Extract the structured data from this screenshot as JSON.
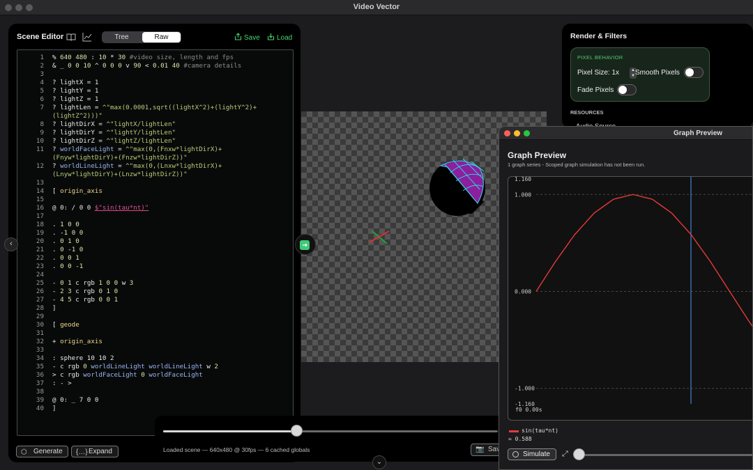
{
  "app": {
    "title": "Video Vector"
  },
  "scene_editor": {
    "title": "Scene Editor",
    "tabs": [
      "Tree",
      "Raw"
    ],
    "active_tab": "Raw",
    "save_label": "Save",
    "load_label": "Load",
    "generate_label": "Generate",
    "expand_label": "Expand",
    "code": [
      {
        "n": "1",
        "t": "% 640 480 : 10 * 30 #video size, length and fps"
      },
      {
        "n": "2",
        "t": "& _ 0 0 10 ^ 0 0 0 v 90 < 0.01 40 #camera details"
      },
      {
        "n": "3",
        "t": ""
      },
      {
        "n": "4",
        "t": "? lightX = 1"
      },
      {
        "n": "5",
        "t": "? lightY = 1"
      },
      {
        "n": "6",
        "t": "? lightZ = 1"
      },
      {
        "n": "7",
        "t": "? lightLen = ^\"max(0.0001,sqrt((lightX^2)+(lightY^2)+"
      },
      {
        "n": "",
        "t": "(lightZ^2)))\""
      },
      {
        "n": "8",
        "t": "? lightDirX = ^\"lightX/lightLen\""
      },
      {
        "n": "9",
        "t": "? lightDirY = ^\"lightY/lightLen\""
      },
      {
        "n": "10",
        "t": "? lightDirZ = ^\"lightZ/lightLen\""
      },
      {
        "n": "11",
        "t": "? worldFaceLight = ^\"max(0,(Fnxw*lightDirX)+"
      },
      {
        "n": "",
        "t": "(Fnyw*lightDirY)+(Fnzw*lightDirZ))\""
      },
      {
        "n": "12",
        "t": "? worldLineLight = ^\"max(0,(Lnxw*lightDirX)+"
      },
      {
        "n": "",
        "t": "(Lnyw*lightDirY)+(Lnzw*lightDirZ))\""
      },
      {
        "n": "13",
        "t": ""
      },
      {
        "n": "14",
        "t": "[ origin_axis"
      },
      {
        "n": "15",
        "t": ""
      },
      {
        "n": "16",
        "t": "@ 0: / 0 0 $\"sin(tau*nt)\""
      },
      {
        "n": "17",
        "t": ""
      },
      {
        "n": "18",
        "t": ". 1 0 0"
      },
      {
        "n": "19",
        "t": ". -1 0 0"
      },
      {
        "n": "20",
        "t": ". 0 1 0"
      },
      {
        "n": "21",
        "t": ". 0 -1 0"
      },
      {
        "n": "22",
        "t": ". 0 0 1"
      },
      {
        "n": "23",
        "t": ". 0 0 -1"
      },
      {
        "n": "24",
        "t": ""
      },
      {
        "n": "25",
        "t": "- 0 1 c rgb 1 0 0 w 3"
      },
      {
        "n": "26",
        "t": "- 2 3 c rgb 0 1 0"
      },
      {
        "n": "27",
        "t": "- 4 5 c rgb 0 0 1"
      },
      {
        "n": "28",
        "t": "]"
      },
      {
        "n": "29",
        "t": ""
      },
      {
        "n": "30",
        "t": "[ geode"
      },
      {
        "n": "31",
        "t": ""
      },
      {
        "n": "32",
        "t": "+ origin_axis"
      },
      {
        "n": "33",
        "t": ""
      },
      {
        "n": "34",
        "t": ": sphere 10 10 2"
      },
      {
        "n": "35",
        "t": "- c rgb 0 worldLineLight worldLineLight w 2"
      },
      {
        "n": "36",
        "t": "> c rgb worldFaceLight 0 worldFaceLight"
      },
      {
        "n": "37",
        "t": ": - >"
      },
      {
        "n": "38",
        "t": ""
      },
      {
        "n": "39",
        "t": "@ 0: _ 7 0 0"
      },
      {
        "n": "40",
        "t": "]"
      }
    ]
  },
  "playback": {
    "status": "Loaded scene — 640x480 @ 30fps — 6 cached globals",
    "progress": 0.4,
    "save_label": "Save"
  },
  "render_panel": {
    "title": "Render & Filters",
    "pixel_behavior_heading": "PIXEL BEHAVIOR",
    "pixel_size_label": "Pixel Size: 1x",
    "smooth_pixels_label": "Smooth Pixels",
    "fade_pixels_label": "Fade Pixels",
    "resources_heading": "RESOURCES",
    "audio_source_label": "Audio Source"
  },
  "graph_preview": {
    "window_title": "Graph Preview",
    "heading": "Graph Preview",
    "subtitle": "1 graph series - Scoped graph simulation has not been run.",
    "legend_name": "sin(tau*nt)",
    "legend_value": "= 0.588",
    "simulate_label": "Simulate",
    "frame_label": "f0 0.00s",
    "y_labels": [
      "1.160",
      "1.000",
      "0.000",
      "-1.000",
      "-1.160"
    ]
  },
  "chart_data": {
    "type": "line",
    "series": [
      {
        "name": "sin(tau*nt)",
        "x": [
          0,
          0.05,
          0.1,
          0.15,
          0.2,
          0.25,
          0.3,
          0.35,
          0.4,
          0.45,
          0.5,
          0.55,
          0.6
        ],
        "values": [
          0,
          0.309,
          0.588,
          0.809,
          0.951,
          1.0,
          0.951,
          0.809,
          0.588,
          0.309,
          0,
          -0.309,
          -0.588
        ]
      }
    ],
    "ylim": [
      -1.16,
      1.16
    ],
    "yticks": [
      1.16,
      1.0,
      0.0,
      -1.0,
      -1.16
    ],
    "cursor_x": 0.4,
    "grid": true
  },
  "colors": {
    "accent_green": "#46d56b",
    "series_red": "#e53a3a",
    "cursor_blue": "#4a7fd0"
  }
}
